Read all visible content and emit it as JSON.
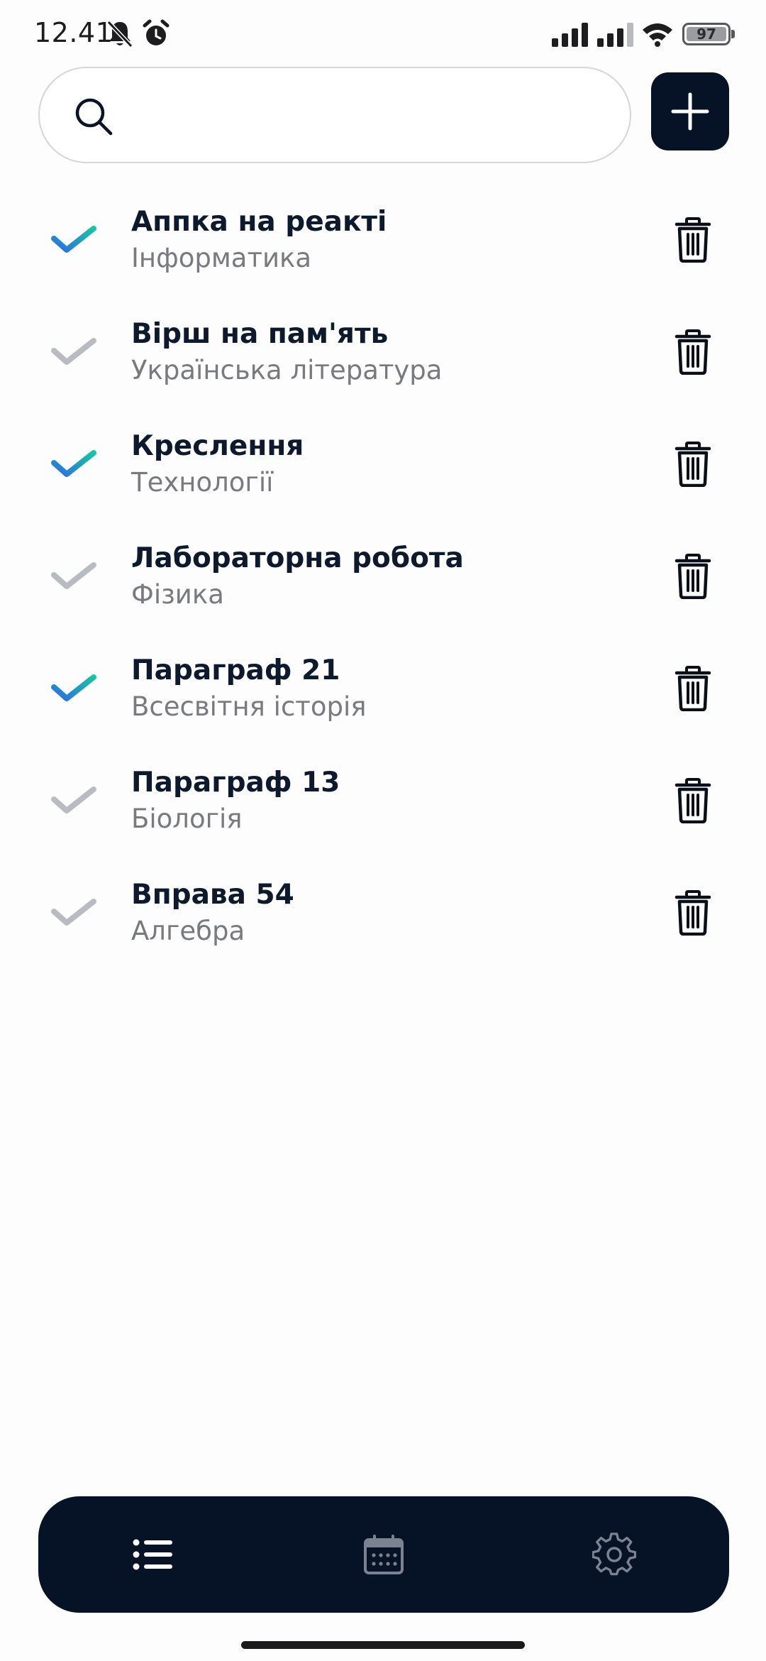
{
  "status_bar": {
    "time": "12.41",
    "battery": "97",
    "icons": [
      "bell-muted-icon",
      "alarm-icon",
      "signal-icon",
      "signal-icon",
      "wifi-icon",
      "battery-icon"
    ]
  },
  "search": {
    "placeholder": "",
    "value": "",
    "icon": "search-icon"
  },
  "add_button": {
    "icon": "plus-icon"
  },
  "tasks": [
    {
      "title": "Аппка на реакті",
      "subject": "Інформатика",
      "done": true
    },
    {
      "title": "Вірш на пам'ять",
      "subject": "Українська література",
      "done": false
    },
    {
      "title": "Креслення",
      "subject": "Технології",
      "done": true
    },
    {
      "title": "Лабораторна робота",
      "subject": "Фізика",
      "done": false
    },
    {
      "title": "Параграф 21",
      "subject": "Всесвітня історія",
      "done": true
    },
    {
      "title": "Параграф 13",
      "subject": "Біологія",
      "done": false
    },
    {
      "title": "Вправа 54",
      "subject": "Алгебра",
      "done": false
    }
  ],
  "bottom_nav": {
    "items": [
      {
        "icon": "list-icon",
        "active": true
      },
      {
        "icon": "calendar-icon",
        "active": false
      },
      {
        "icon": "settings-gear-icon",
        "active": false
      }
    ]
  },
  "colors": {
    "navy": "#061327",
    "check_done_start": "#2b6fe0",
    "check_done_end": "#19c4a4",
    "check_pending": "#b9bbc2",
    "subtitle": "#787a80"
  }
}
